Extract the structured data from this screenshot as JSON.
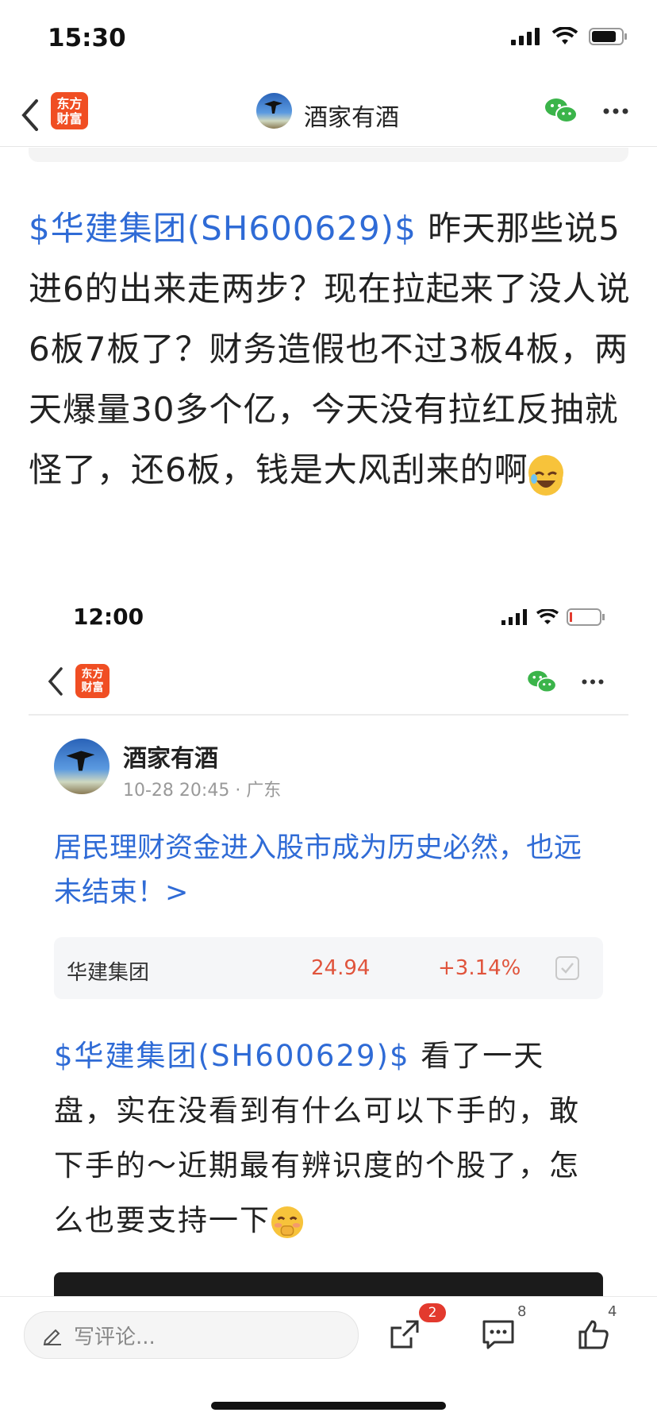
{
  "status_bar": {
    "time": "15:30"
  },
  "nav": {
    "logo_line1": "东方",
    "logo_line2": "财富",
    "title": "酒家有酒"
  },
  "post": {
    "stock_tag": "$华建集团(SH600629)$",
    "text": " 昨天那些说5进6的出来走两步？现在拉起来了没人说6板7板了？财务造假也不过3板4板，两天爆量30多个亿，今天没有拉红反抽就怪了，还6板，钱是大风刮来的啊"
  },
  "screenshot": {
    "status_time": "12:00",
    "nav": {
      "logo_line1": "东方",
      "logo_line2": "财富"
    },
    "author": {
      "name": "酒家有酒",
      "meta": "10-28 20:45 · 广东"
    },
    "headline": "居民理财资金进入股市成为历史必然，也远未结束！>",
    "stock": {
      "name": "华建集团",
      "price": "24.94",
      "change": "+3.14%"
    },
    "body_stock_tag": "$华建集团(SH600629)$",
    "body_text": "  看了一天盘，实在没看到有什么可以下手的，敢下手的～近期最有辨识度的个股了，怎么也要支持一下"
  },
  "bottom_bar": {
    "comment_placeholder": "写评论...",
    "share_badge": "2",
    "comment_count": "8",
    "like_count": "4"
  },
  "icons": [
    "back-arrow-icon",
    "wechat-icon",
    "more-icon",
    "edit-icon",
    "share-icon",
    "comment-icon",
    "like-icon",
    "signal-icon",
    "wifi-icon",
    "battery-icon",
    "laughing-emoji-icon",
    "shy-emoji-icon"
  ]
}
